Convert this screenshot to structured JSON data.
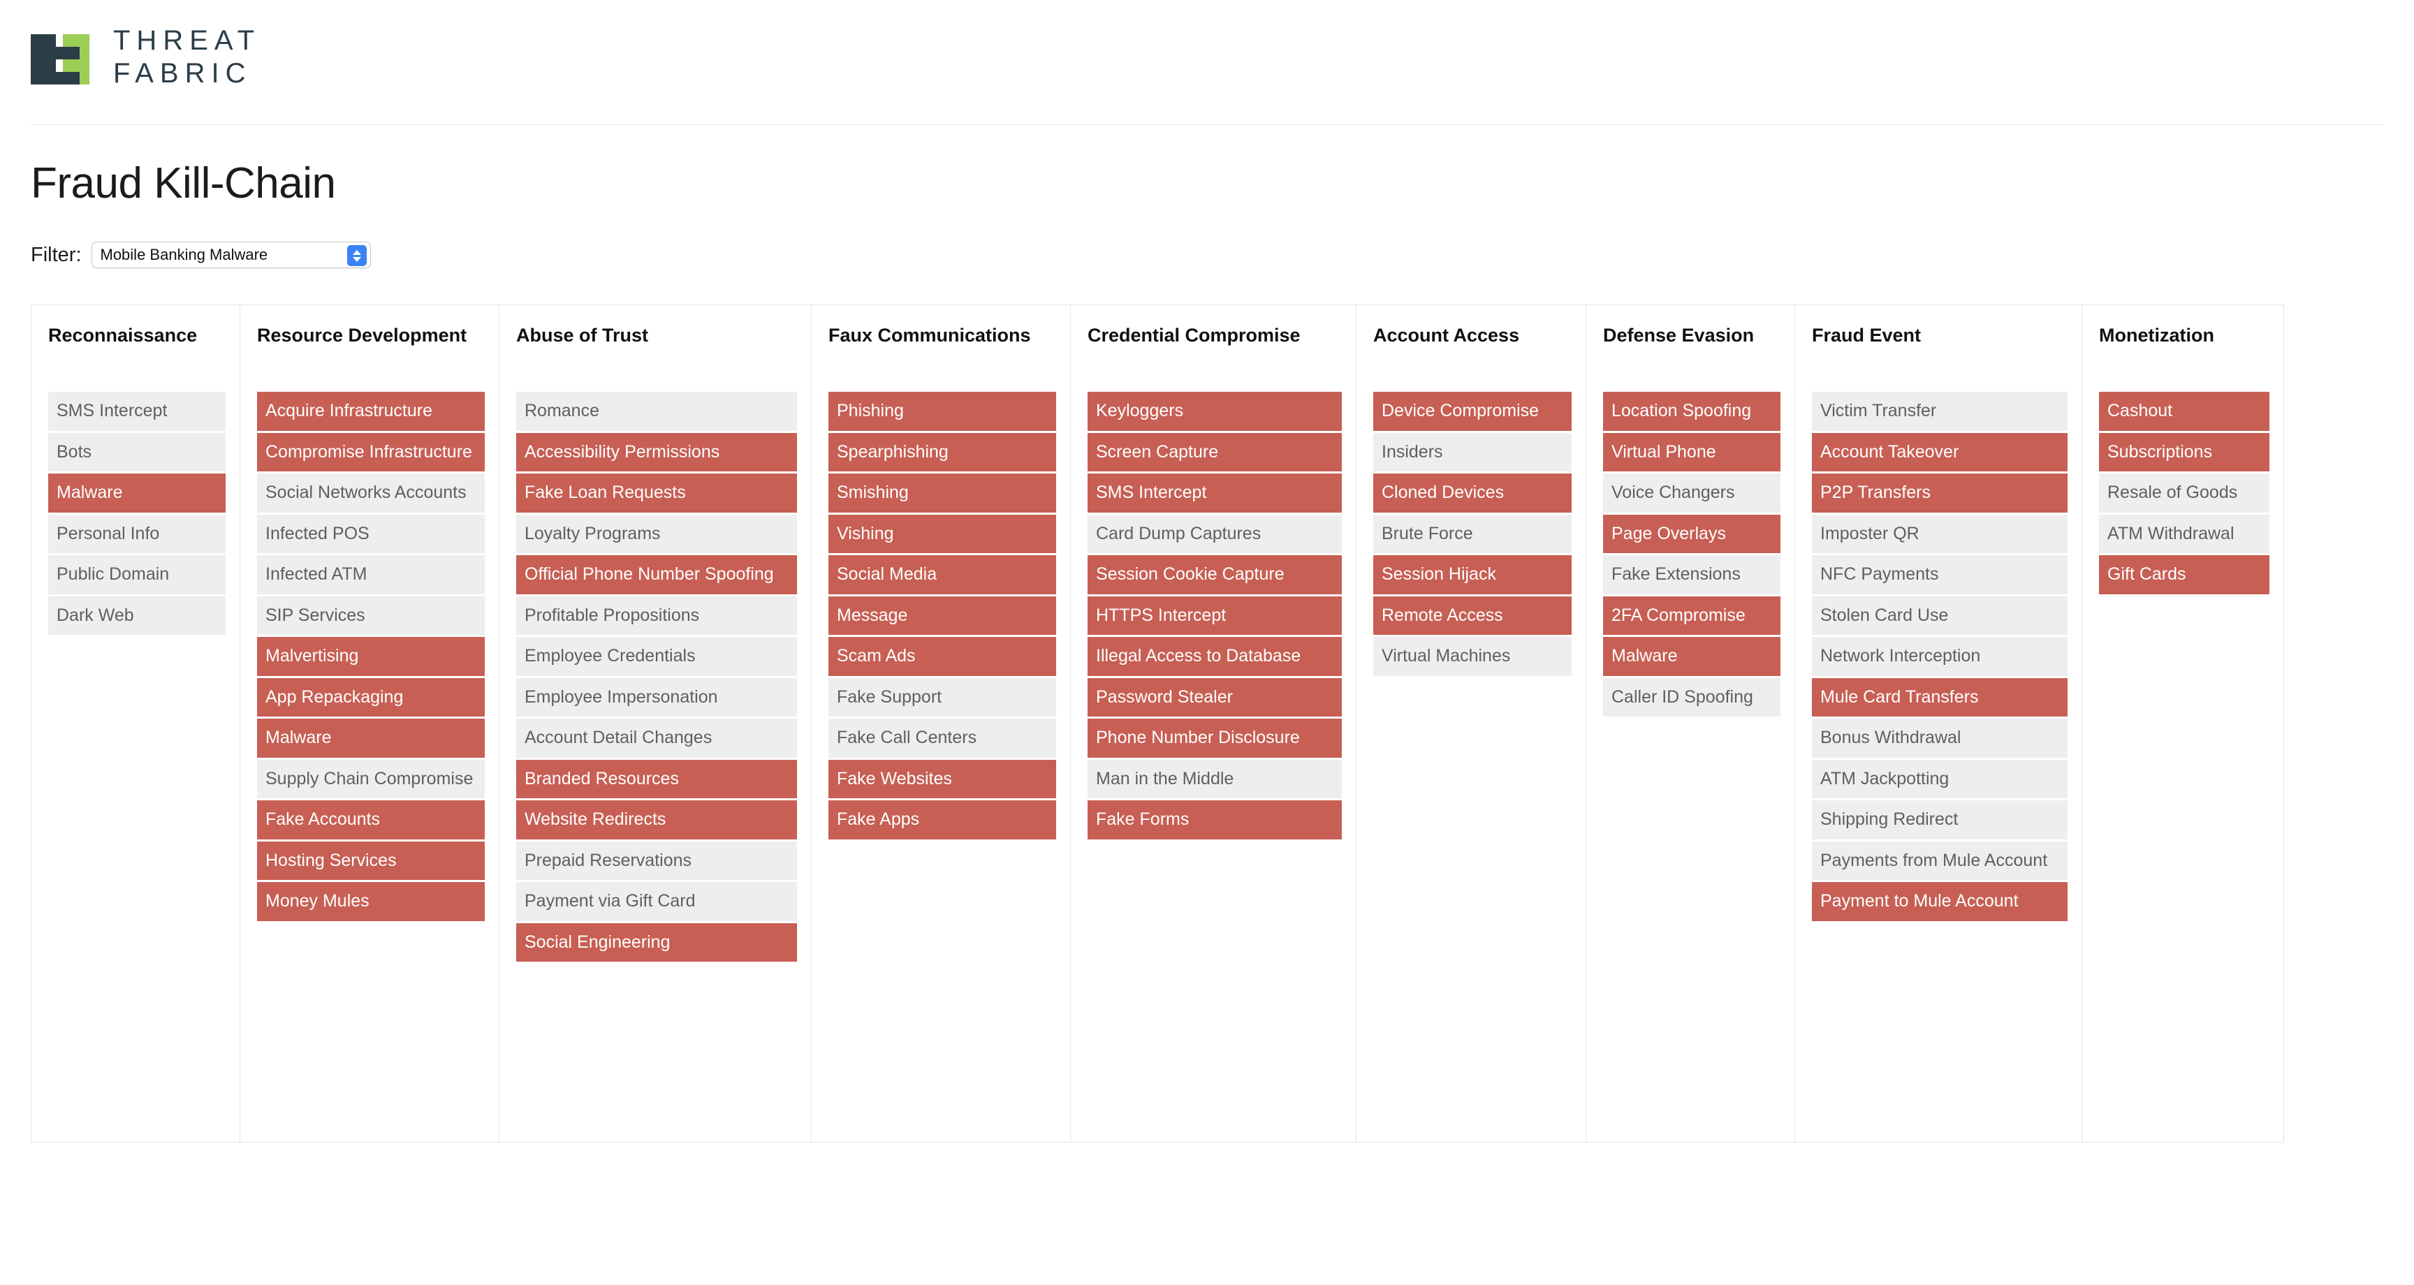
{
  "brand": {
    "logo_icon": "threatfabric-logo-icon",
    "line1": "THREAT",
    "line2": "FABRIC"
  },
  "page_title": "Fraud Kill-Chain",
  "filter": {
    "label": "Filter:",
    "selected_value": "Mobile Banking Malware",
    "stepper_icon": "chevron-up-down-icon"
  },
  "colors": {
    "active": "#c75f54",
    "inactive_bg": "#eeeeee",
    "inactive_text": "#5f5f5f",
    "brand_dark": "#2c3d47",
    "brand_green": "#9ccd54",
    "accent_blue": "#3b82f6"
  },
  "board": {
    "columns": [
      {
        "title": "Reconnaissance",
        "items": [
          {
            "label": "SMS Intercept",
            "active": false
          },
          {
            "label": "Bots",
            "active": false
          },
          {
            "label": "Malware",
            "active": true
          },
          {
            "label": "Personal Info",
            "active": false
          },
          {
            "label": "Public Domain",
            "active": false
          },
          {
            "label": "Dark Web",
            "active": false
          }
        ]
      },
      {
        "title": "Resource Development",
        "items": [
          {
            "label": "Acquire Infrastructure",
            "active": true
          },
          {
            "label": "Compromise Infrastructure",
            "active": true
          },
          {
            "label": "Social Networks Accounts",
            "active": false
          },
          {
            "label": "Infected POS",
            "active": false
          },
          {
            "label": "Infected ATM",
            "active": false
          },
          {
            "label": "SIP Services",
            "active": false
          },
          {
            "label": "Malvertising",
            "active": true
          },
          {
            "label": "App Repackaging",
            "active": true
          },
          {
            "label": "Malware",
            "active": true
          },
          {
            "label": "Supply Chain Compromise",
            "active": false
          },
          {
            "label": "Fake Accounts",
            "active": true
          },
          {
            "label": "Hosting Services",
            "active": true
          },
          {
            "label": "Money Mules",
            "active": true
          }
        ]
      },
      {
        "title": "Abuse of Trust",
        "items": [
          {
            "label": "Romance",
            "active": false
          },
          {
            "label": "Accessibility Permissions",
            "active": true
          },
          {
            "label": "Fake Loan Requests",
            "active": true
          },
          {
            "label": "Loyalty Programs",
            "active": false
          },
          {
            "label": "Official Phone Number Spoofing",
            "active": true
          },
          {
            "label": "Profitable Propositions",
            "active": false
          },
          {
            "label": "Employee Credentials",
            "active": false
          },
          {
            "label": "Employee Impersonation",
            "active": false
          },
          {
            "label": "Account Detail Changes",
            "active": false
          },
          {
            "label": "Branded Resources",
            "active": true
          },
          {
            "label": "Website Redirects",
            "active": true
          },
          {
            "label": "Prepaid Reservations",
            "active": false
          },
          {
            "label": "Payment via Gift Card",
            "active": false
          },
          {
            "label": "Social Engineering",
            "active": true
          }
        ]
      },
      {
        "title": "Faux Communications",
        "items": [
          {
            "label": "Phishing",
            "active": true
          },
          {
            "label": "Spearphishing",
            "active": true
          },
          {
            "label": "Smishing",
            "active": true
          },
          {
            "label": "Vishing",
            "active": true
          },
          {
            "label": "Social Media",
            "active": true
          },
          {
            "label": "Message",
            "active": true
          },
          {
            "label": "Scam Ads",
            "active": true
          },
          {
            "label": "Fake Support",
            "active": false
          },
          {
            "label": "Fake Call Centers",
            "active": false
          },
          {
            "label": "Fake Websites",
            "active": true
          },
          {
            "label": "Fake Apps",
            "active": true
          }
        ]
      },
      {
        "title": "Credential Compromise",
        "items": [
          {
            "label": "Keyloggers",
            "active": true
          },
          {
            "label": "Screen Capture",
            "active": true
          },
          {
            "label": "SMS Intercept",
            "active": true
          },
          {
            "label": "Card Dump Captures",
            "active": false
          },
          {
            "label": "Session Cookie Capture",
            "active": true
          },
          {
            "label": "HTTPS Intercept",
            "active": true
          },
          {
            "label": "Illegal Access to Database",
            "active": true
          },
          {
            "label": "Password Stealer",
            "active": true
          },
          {
            "label": "Phone Number Disclosure",
            "active": true
          },
          {
            "label": "Man in the Middle",
            "active": false
          },
          {
            "label": "Fake Forms",
            "active": true
          }
        ]
      },
      {
        "title": "Account Access",
        "items": [
          {
            "label": "Device Compromise",
            "active": true
          },
          {
            "label": "Insiders",
            "active": false
          },
          {
            "label": "Cloned Devices",
            "active": true
          },
          {
            "label": "Brute Force",
            "active": false
          },
          {
            "label": "Session Hijack",
            "active": true
          },
          {
            "label": "Remote Access",
            "active": true
          },
          {
            "label": "Virtual Machines",
            "active": false
          }
        ]
      },
      {
        "title": "Defense Evasion",
        "items": [
          {
            "label": "Location Spoofing",
            "active": true
          },
          {
            "label": "Virtual Phone",
            "active": true
          },
          {
            "label": "Voice Changers",
            "active": false
          },
          {
            "label": "Page Overlays",
            "active": true
          },
          {
            "label": "Fake Extensions",
            "active": false
          },
          {
            "label": "2FA Compromise",
            "active": true
          },
          {
            "label": "Malware",
            "active": true
          },
          {
            "label": "Caller ID Spoofing",
            "active": false
          }
        ]
      },
      {
        "title": "Fraud Event",
        "items": [
          {
            "label": "Victim Transfer",
            "active": false
          },
          {
            "label": "Account Takeover",
            "active": true
          },
          {
            "label": "P2P Transfers",
            "active": true
          },
          {
            "label": "Imposter QR",
            "active": false
          },
          {
            "label": "NFC Payments",
            "active": false
          },
          {
            "label": "Stolen Card Use",
            "active": false
          },
          {
            "label": "Network Interception",
            "active": false
          },
          {
            "label": "Mule Card Transfers",
            "active": true
          },
          {
            "label": "Bonus Withdrawal",
            "active": false
          },
          {
            "label": "ATM Jackpotting",
            "active": false
          },
          {
            "label": "Shipping Redirect",
            "active": false
          },
          {
            "label": "Payments from Mule Account",
            "active": false
          },
          {
            "label": "Payment to Mule Account",
            "active": true
          }
        ]
      },
      {
        "title": "Monetization",
        "items": [
          {
            "label": "Cashout",
            "active": true
          },
          {
            "label": "Subscriptions",
            "active": true
          },
          {
            "label": "Resale of Goods",
            "active": false
          },
          {
            "label": "ATM Withdrawal",
            "active": false
          },
          {
            "label": "Gift Cards",
            "active": true
          }
        ]
      }
    ]
  }
}
